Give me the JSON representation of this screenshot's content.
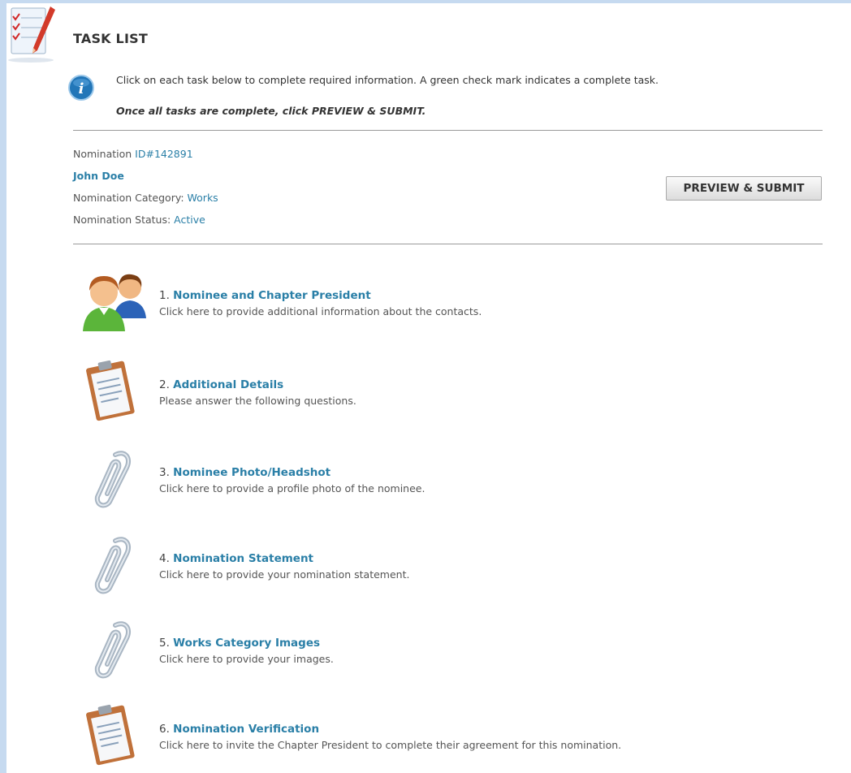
{
  "header": {
    "title": "TASK LIST",
    "info_text": "Click on each task below to complete required information. A green check mark indicates a complete task.",
    "info_note": "Once all tasks are complete, click PREVIEW & SUBMIT."
  },
  "nomination": {
    "id_label": "Nomination ",
    "id_value": "ID#142891",
    "name": "John Doe",
    "category_label": "Nomination Category: ",
    "category_value": "Works",
    "status_label": "Nomination Status: ",
    "status_value": "Active"
  },
  "actions": {
    "preview_submit_label": "PREVIEW & SUBMIT"
  },
  "tasks": [
    {
      "number": "1. ",
      "title": "Nominee and Chapter President",
      "description": "Click here to provide additional information about the contacts.",
      "icon": "people-icon"
    },
    {
      "number": "2. ",
      "title": "Additional Details",
      "description": "Please answer the following questions.",
      "icon": "clipboard-icon"
    },
    {
      "number": "3. ",
      "title": "Nominee Photo/Headshot",
      "description": "Click here to provide a profile photo of the nominee.",
      "icon": "paperclip-icon"
    },
    {
      "number": "4. ",
      "title": "Nomination Statement",
      "description": "Click here to provide your nomination statement.",
      "icon": "paperclip-icon"
    },
    {
      "number": "5. ",
      "title": "Works Category Images",
      "description": "Click here to provide your images.",
      "icon": "paperclip-icon"
    },
    {
      "number": "6. ",
      "title": "Nomination Verification",
      "description": "Click here to invite the Chapter President to complete their agreement for this nomination.",
      "icon": "clipboard-icon"
    }
  ],
  "colors": {
    "link": "#2a7fa7",
    "background": "#c6daf0",
    "panel": "#ffffff"
  }
}
